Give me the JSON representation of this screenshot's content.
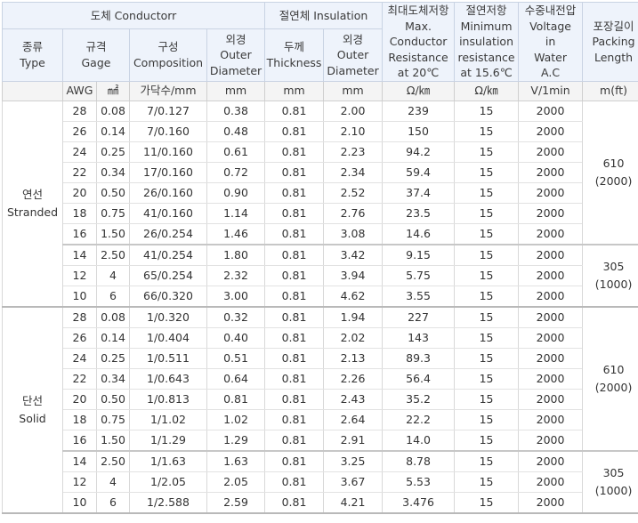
{
  "headers": {
    "conductor_group": "도체 Conductorr",
    "insulation_group": "절연체 Insulation",
    "type": [
      "종류",
      "Type"
    ],
    "gage": [
      "규격",
      "Gage"
    ],
    "composition": [
      "구성",
      "Composition"
    ],
    "conductor_od": [
      "외경",
      "Outer",
      "Diameter"
    ],
    "thickness": [
      "두께",
      "Thickness"
    ],
    "insulation_od": [
      "외경",
      "Outer",
      "Diameter"
    ],
    "max_resistance": [
      "최대도체저항",
      "Max.",
      "Conductor",
      "Resistance",
      "at 20℃"
    ],
    "min_insulation": [
      "절연저항",
      "Minimum",
      "insulation",
      "resistance",
      "at 15.6℃"
    ],
    "voltage": [
      "수중내전압",
      "Voltage",
      "in",
      "Water",
      "A.C"
    ],
    "packing": [
      "포장길이",
      "Packing",
      "Length"
    ]
  },
  "units": {
    "awg": "AWG",
    "mm2": "㎟",
    "composition": "가닥수/mm",
    "conductor_od": "mm",
    "thickness": "mm",
    "insulation_od": "mm",
    "resistance": "Ω/㎞",
    "insulation": "Ω/㎞",
    "voltage": "V/1min",
    "packing": "m(ft)"
  },
  "groups": [
    {
      "type": [
        "연선",
        "Stranded"
      ],
      "packing": [
        {
          "text": [
            "610",
            "(2000)"
          ],
          "rows": 7
        },
        {
          "text": [
            "305",
            "(1000)"
          ],
          "rows": 3
        }
      ],
      "rows": [
        [
          "28",
          "0.08",
          "7/0.127",
          "0.38",
          "0.81",
          "2.00",
          "239",
          "15",
          "2000"
        ],
        [
          "26",
          "0.14",
          "7/0.160",
          "0.48",
          "0.81",
          "2.10",
          "150",
          "15",
          "2000"
        ],
        [
          "24",
          "0.25",
          "11/0.160",
          "0.61",
          "0.81",
          "2.23",
          "94.2",
          "15",
          "2000"
        ],
        [
          "22",
          "0.34",
          "17/0.160",
          "0.72",
          "0.81",
          "2.34",
          "59.4",
          "15",
          "2000"
        ],
        [
          "20",
          "0.50",
          "26/0.160",
          "0.90",
          "0.81",
          "2.52",
          "37.4",
          "15",
          "2000"
        ],
        [
          "18",
          "0.75",
          "41/0.160",
          "1.14",
          "0.81",
          "2.76",
          "23.5",
          "15",
          "2000"
        ],
        [
          "16",
          "1.50",
          "26/0.254",
          "1.46",
          "0.81",
          "3.08",
          "14.6",
          "15",
          "2000"
        ],
        [
          "14",
          "2.50",
          "41/0.254",
          "1.80",
          "0.81",
          "3.42",
          "9.15",
          "15",
          "2000"
        ],
        [
          "12",
          "4",
          "65/0.254",
          "2.32",
          "0.81",
          "3.94",
          "5.75",
          "15",
          "2000"
        ],
        [
          "10",
          "6",
          "66/0.320",
          "3.00",
          "0.81",
          "4.62",
          "3.55",
          "15",
          "2000"
        ]
      ]
    },
    {
      "type": [
        "단선",
        "Solid"
      ],
      "packing": [
        {
          "text": [
            "610",
            "(2000)"
          ],
          "rows": 7
        },
        {
          "text": [
            "305",
            "(1000)"
          ],
          "rows": 3
        }
      ],
      "rows": [
        [
          "28",
          "0.08",
          "1/0.320",
          "0.32",
          "0.81",
          "1.94",
          "227",
          "15",
          "2000"
        ],
        [
          "26",
          "0.14",
          "1/0.404",
          "0.40",
          "0.81",
          "2.02",
          "143",
          "15",
          "2000"
        ],
        [
          "24",
          "0.25",
          "1/0.511",
          "0.51",
          "0.81",
          "2.13",
          "89.3",
          "15",
          "2000"
        ],
        [
          "22",
          "0.34",
          "1/0.643",
          "0.64",
          "0.81",
          "2.26",
          "56.4",
          "15",
          "2000"
        ],
        [
          "20",
          "0.50",
          "1/0.813",
          "0.81",
          "0.81",
          "2.43",
          "35.2",
          "15",
          "2000"
        ],
        [
          "18",
          "0.75",
          "1/1.02",
          "1.02",
          "0.81",
          "2.64",
          "22.2",
          "15",
          "2000"
        ],
        [
          "16",
          "1.50",
          "1/1.29",
          "1.29",
          "0.81",
          "2.91",
          "14.0",
          "15",
          "2000"
        ],
        [
          "14",
          "2.50",
          "1/1.63",
          "1.63",
          "0.81",
          "3.25",
          "8.78",
          "15",
          "2000"
        ],
        [
          "12",
          "4",
          "1/2.05",
          "2.05",
          "0.81",
          "3.67",
          "5.53",
          "15",
          "2000"
        ],
        [
          "10",
          "6",
          "1/2.588",
          "2.59",
          "0.81",
          "4.21",
          "3.476",
          "15",
          "2000"
        ]
      ]
    }
  ]
}
